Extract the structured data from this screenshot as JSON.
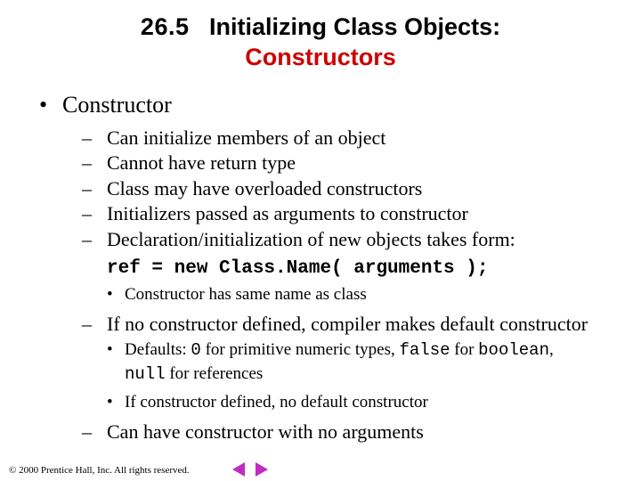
{
  "title": {
    "number": "26.5",
    "line1": "Initializing Class Objects:",
    "line2": "Constructors"
  },
  "main_bullet": "Constructor",
  "sub_bullets_a": [
    "Can initialize members of an object",
    "Cannot have return type",
    "Class may have overloaded constructors",
    "Initializers passed as arguments to constructor",
    "Declaration/initialization of new objects takes form:"
  ],
  "code_line": "ref = new Class.Name( arguments );",
  "sub3_a": "Constructor has same name as class",
  "sub_b": "If no constructor defined, compiler makes default constructor",
  "sub3_b1_pre": "Defaults: ",
  "sub3_b1_c1": "0",
  "sub3_b1_mid1": " for primitive numeric types, ",
  "sub3_b1_c2": "false",
  "sub3_b1_mid2": " for ",
  "sub3_b1_c3": "boolean",
  "sub3_b1_mid3": ", ",
  "sub3_b1_c4": "null",
  "sub3_b1_post": " for references",
  "sub3_b2": "If constructor defined, no default constructor",
  "sub_c": "Can have constructor with no arguments",
  "footer": "© 2000 Prentice Hall, Inc. All rights reserved."
}
